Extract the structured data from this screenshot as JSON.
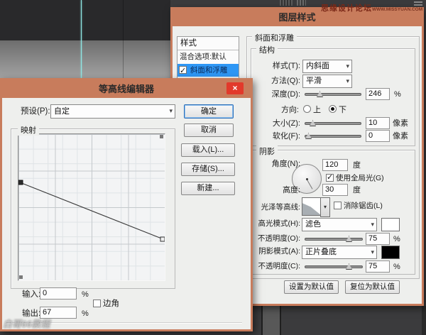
{
  "watermarks": {
    "forum": "思缘设计论坛",
    "forum_url": "WWW.MISSYUAN.COM",
    "author": "白哥66教程"
  },
  "colors": {
    "accent_titlebar": "#c87c5c",
    "dialog_bg": "#eeefed",
    "selection_blue": "#2f97f5",
    "close_red": "#e2392b",
    "guide_cyan": "#8fe8e6",
    "highlight_swatch": "#ffffff",
    "shadow_swatch": "#000000"
  },
  "layer_style": {
    "title": "图层样式",
    "styles_panel": {
      "header": "样式",
      "blend_options": "混合选项:默认",
      "bevel_item": "斜面和浮雕"
    },
    "bevel": {
      "section_title": "斜面和浮雕",
      "structure": {
        "title": "结构",
        "style_label": "样式(T):",
        "style_value": "内斜面",
        "technique_label": "方法(Q):",
        "technique_value": "平滑",
        "depth_label": "深度(D):",
        "depth_value": "246",
        "depth_unit": "%",
        "direction_label": "方向:",
        "direction_up": "上",
        "direction_down": "下",
        "size_label": "大小(Z):",
        "size_value": "10",
        "size_unit": "像素",
        "soften_label": "软化(F):",
        "soften_value": "0",
        "soften_unit": "像素"
      },
      "shading": {
        "title": "阴影",
        "angle_label": "角度(N):",
        "angle_value": "120",
        "angle_unit": "度",
        "use_global_light": "使用全局光(G)",
        "altitude_label": "高度:",
        "altitude_value": "30",
        "altitude_unit": "度",
        "gloss_contour_label": "光泽等高线:",
        "anti_aliased": "消除锯齿(L)",
        "highlight_mode_label": "高光模式(H):",
        "highlight_mode_value": "滤色",
        "highlight_opacity_label": "不透明度(O):",
        "highlight_opacity_value": "75",
        "highlight_opacity_unit": "%",
        "shadow_mode_label": "阴影模式(A):",
        "shadow_mode_value": "正片叠底",
        "shadow_opacity_label": "不透明度(C):",
        "shadow_opacity_value": "75",
        "shadow_opacity_unit": "%"
      },
      "set_default": "设置为默认值",
      "reset_default": "复位为默认值"
    }
  },
  "contour_editor": {
    "title": "等高线编辑器",
    "preset_label": "预设(P):",
    "preset_value": "自定",
    "ok": "确定",
    "cancel": "取消",
    "load": "载入(L)...",
    "save": "存储(S)...",
    "new": "新建...",
    "mapping": "映射",
    "input_label": "输入:",
    "input_value": "0",
    "input_unit": "%",
    "output_label": "输出:",
    "output_value": "67",
    "output_unit": "%",
    "corner": "边角",
    "curve": {
      "points": [
        {
          "input": 0,
          "output": 67,
          "selected": true
        },
        {
          "input": 100,
          "output": 28,
          "selected": false
        }
      ]
    }
  }
}
